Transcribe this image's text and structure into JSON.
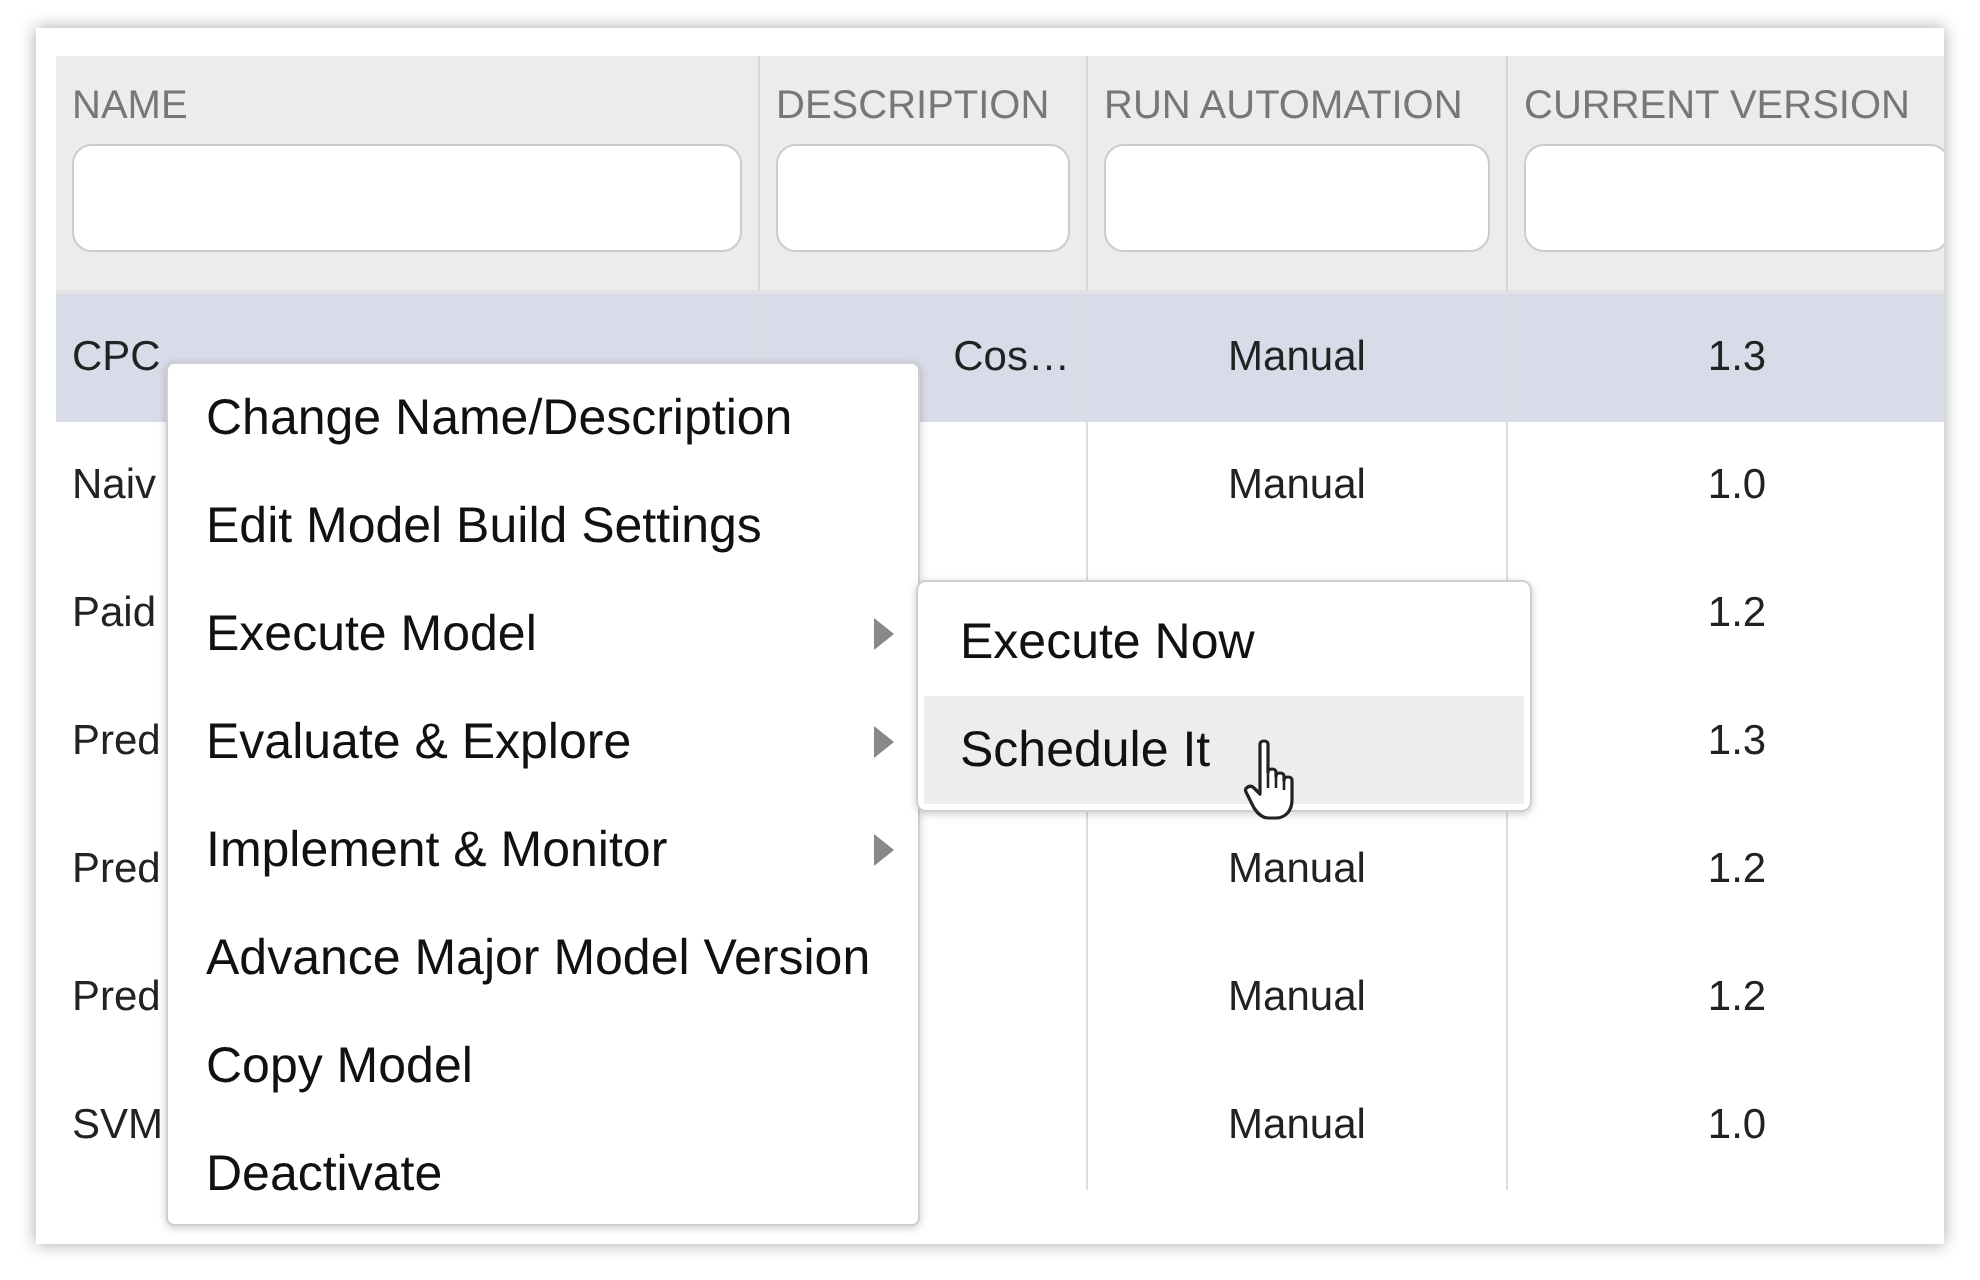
{
  "table": {
    "columns": [
      {
        "label": "NAME"
      },
      {
        "label": "DESCRIPTION"
      },
      {
        "label": "RUN AUTOMATION"
      },
      {
        "label": "CURRENT VERSION"
      }
    ],
    "rows": [
      {
        "selected": true,
        "cells": [
          "CPC",
          "Cos…",
          "Manual",
          "1.3"
        ]
      },
      {
        "selected": false,
        "cells": [
          "Naiv",
          "",
          "Manual",
          "1.0"
        ]
      },
      {
        "selected": false,
        "cells": [
          "Paid",
          "",
          "",
          "1.2"
        ]
      },
      {
        "selected": false,
        "cells": [
          "Pred",
          "",
          "",
          "1.3"
        ]
      },
      {
        "selected": false,
        "cells": [
          "Pred",
          "",
          "Manual",
          "1.2"
        ]
      },
      {
        "selected": false,
        "cells": [
          "Pred",
          "",
          "Manual",
          "1.2"
        ]
      },
      {
        "selected": false,
        "cells": [
          "SVM",
          "",
          "Manual",
          "1.0"
        ]
      }
    ]
  },
  "context_menu": {
    "items": [
      {
        "label": "Change Name/Description",
        "submenu": false
      },
      {
        "label": "Edit Model Build Settings",
        "submenu": false
      },
      {
        "label": "Execute Model",
        "submenu": true
      },
      {
        "label": "Evaluate & Explore",
        "submenu": true
      },
      {
        "label": "Implement & Monitor",
        "submenu": true
      },
      {
        "label": "Advance Major Model Version",
        "submenu": false
      },
      {
        "label": "Copy Model",
        "submenu": false
      },
      {
        "label": "Deactivate",
        "submenu": false
      }
    ],
    "submenu": {
      "items": [
        {
          "label": "Execute Now",
          "selected": false
        },
        {
          "label": "Schedule It",
          "selected": true
        }
      ]
    }
  }
}
